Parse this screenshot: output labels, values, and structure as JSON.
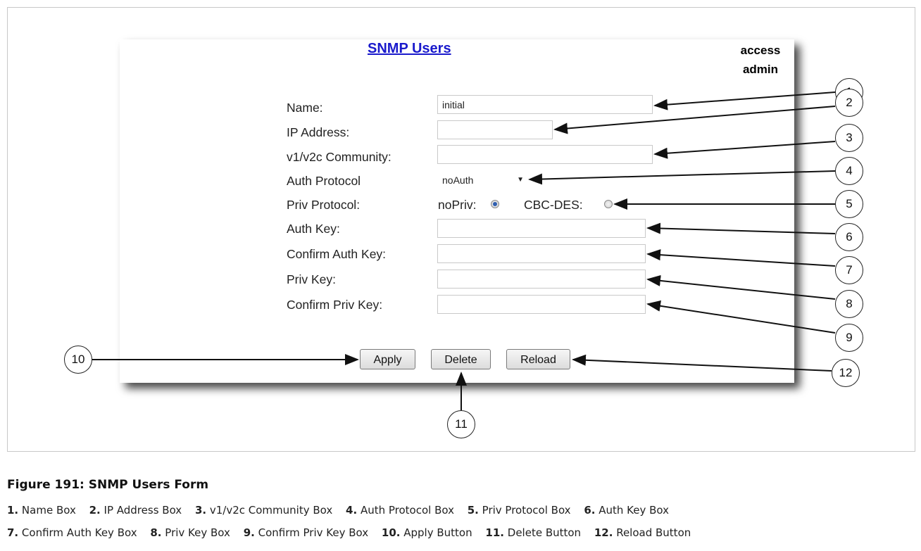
{
  "form": {
    "title": "SNMP Users",
    "access_line1": "access",
    "access_line2": "admin",
    "fields": {
      "name_label": "Name:",
      "name_value": "initial",
      "ip_label": "IP Address:",
      "ip_value": "",
      "community_label": "v1/v2c Community:",
      "community_value": "",
      "auth_protocol_label": "Auth Protocol",
      "auth_protocol_value": "noAuth",
      "priv_protocol_label": "Priv Protocol:",
      "priv_option_1": "noPriv:",
      "priv_option_2": "CBC-DES:",
      "auth_key_label": "Auth Key:",
      "confirm_auth_key_label": "Confirm Auth Key:",
      "priv_key_label": "Priv Key:",
      "confirm_priv_key_label": "Confirm Priv Key:"
    },
    "buttons": {
      "apply": "Apply",
      "delete": "Delete",
      "reload": "Reload"
    }
  },
  "callouts": [
    "1",
    "2",
    "3",
    "4",
    "5",
    "6",
    "7",
    "8",
    "9",
    "10",
    "11",
    "12"
  ],
  "caption": "Figure 191: SNMP Users Form",
  "legend": [
    {
      "num": "1.",
      "text": "Name Box"
    },
    {
      "num": "2.",
      "text": "IP Address Box"
    },
    {
      "num": "3.",
      "text": "v1/v2c Community Box"
    },
    {
      "num": "4.",
      "text": "Auth Protocol Box"
    },
    {
      "num": "5.",
      "text": "Priv Protocol Box"
    },
    {
      "num": "6.",
      "text": "Auth Key Box"
    },
    {
      "num": "7.",
      "text": "Confirm Auth Key Box"
    },
    {
      "num": "8.",
      "text": "Priv Key Box"
    },
    {
      "num": "9.",
      "text": "Confirm Priv Key Box"
    },
    {
      "num": "10.",
      "text": "Apply Button"
    },
    {
      "num": "11.",
      "text": "Delete Button"
    },
    {
      "num": "12.",
      "text": "Reload Button"
    }
  ],
  "colors": {
    "title_link": "#1a1acc",
    "radio_selected": "#2f5fb0"
  }
}
